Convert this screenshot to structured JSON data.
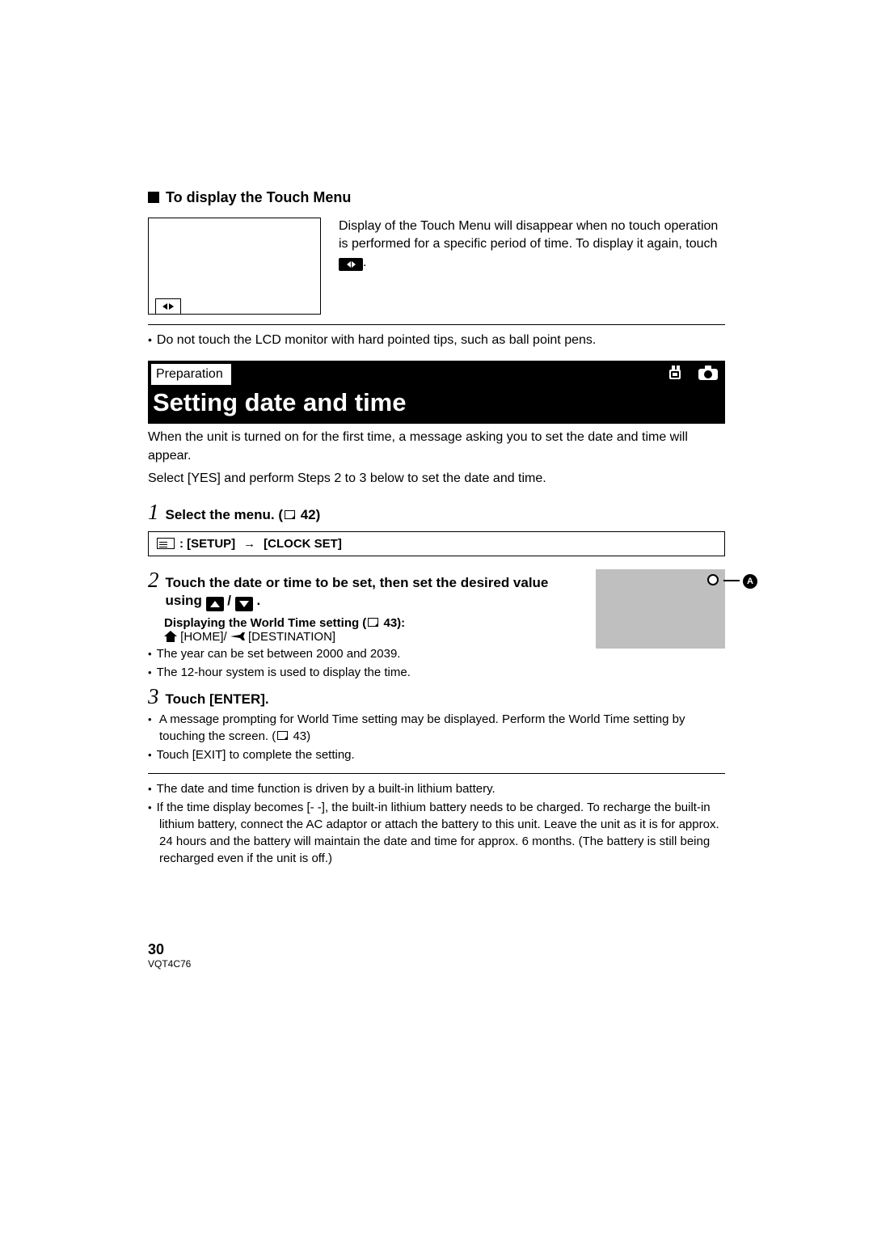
{
  "section1": {
    "heading": "To display the Touch Menu",
    "paragraph_part1": "Display of the Touch Menu will disappear when no touch operation is performed for a specific period of time. To display it again, touch ",
    "paragraph_part2": ".",
    "note": "Do not touch the LCD monitor with hard pointed tips, such as ball point pens."
  },
  "prep": {
    "label": "Preparation",
    "title": "Setting date and time"
  },
  "intro": {
    "line1": "When the unit is turned on for the first time, a message asking you to set the date and time will appear.",
    "line2": "Select [YES] and perform Steps 2 to 3 below to set the date and time."
  },
  "step1": {
    "num": "1",
    "text_before": "Select the menu. (",
    "page": "42",
    "text_after": ")",
    "menu_path1": ": [SETUP]",
    "menu_path2": "[CLOCK SET]"
  },
  "step2": {
    "num": "2",
    "text": "Touch the date or time to be set, then set the desired value using ",
    "slash": " / ",
    "period": " .",
    "world_time_label_before": "Displaying the World Time setting (",
    "world_time_page": "43",
    "world_time_label_after": "):",
    "home_label": " [HOME]/ ",
    "dest_label": " [DESTINATION]",
    "bullet1": "The year can be set between 2000 and 2039.",
    "bullet2": "The 12-hour system is used to display the time.",
    "marker": "A"
  },
  "step3": {
    "num": "3",
    "text": "Touch [ENTER].",
    "bullet1_before": "A message prompting for World Time setting may be displayed. Perform the World Time setting by touching the screen. (",
    "bullet1_page": "43",
    "bullet1_after": ")",
    "bullet2": "Touch [EXIT] to complete the setting."
  },
  "footer_notes": {
    "b1": "The date and time function is driven by a built-in lithium battery.",
    "b2": "If the time display becomes [- -], the built-in lithium battery needs to be charged. To recharge the built-in lithium battery, connect the AC adaptor or attach the battery to this unit. Leave the unit as it is for approx. 24 hours and the battery will maintain the date and time for approx. 6 months. (The battery is still being recharged even if the unit is off.)"
  },
  "footer": {
    "page_num": "30",
    "doc_code": "VQT4C76"
  }
}
